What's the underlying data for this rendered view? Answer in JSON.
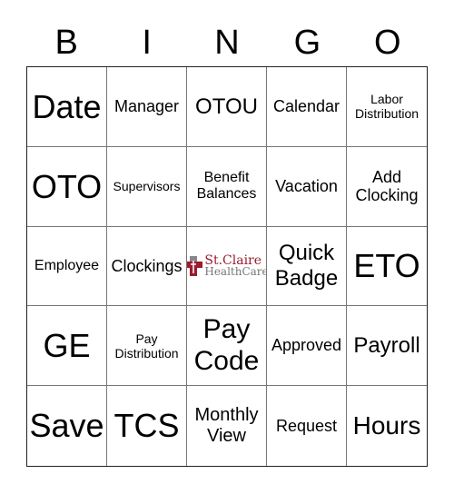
{
  "header": [
    "B",
    "I",
    "N",
    "G",
    "O"
  ],
  "cells": [
    "Date",
    "Manager",
    "OTOU",
    "Calendar",
    "Labor Distribution",
    "OTO",
    "Supervisors",
    "Benefit Balances",
    "Vacation",
    "Add Clocking",
    "Employee",
    "Clockings",
    "",
    "Quick Badge",
    "ETO",
    "GE",
    "Pay Distribution",
    "Pay Code",
    "Approved",
    "Payroll",
    "Save",
    "TCS",
    "Monthly View",
    "Request",
    "Hours"
  ],
  "free_space": {
    "line1": "St.Claire",
    "line2": "HealthCare",
    "icon": "cross-logo-icon"
  },
  "colors": {
    "brand": "#9b1c2e",
    "brand_gray": "#777777"
  }
}
